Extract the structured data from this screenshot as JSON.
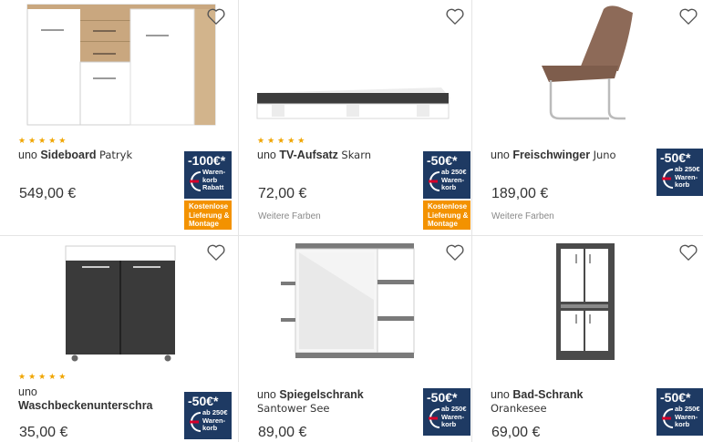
{
  "products": [
    {
      "brand": "uno",
      "name": "Sideboard",
      "suffix": "Patryk",
      "rating": "★★★★★",
      "price": "549,00 €",
      "colors_link": "",
      "badge": {
        "amount": "-100€*",
        "note": "Waren-korb Rabatt"
      },
      "delivery": "Kostenlose Lieferung & Montage"
    },
    {
      "brand": "uno",
      "name": "TV-Aufsatz",
      "suffix": "Skarn",
      "rating": "★★★★★",
      "price": "72,00 €",
      "colors_link": "Weitere Farben",
      "badge": {
        "amount": "-50€*",
        "note": "ab 250€ Waren-korb"
      },
      "delivery": "Kostenlose Lieferung & Montage"
    },
    {
      "brand": "uno",
      "name": "Freischwinger",
      "suffix": "Juno",
      "rating": "",
      "price": "189,00 €",
      "colors_link": "Weitere Farben",
      "badge": {
        "amount": "-50€*",
        "note": "ab 250€ Waren-korb"
      },
      "delivery": ""
    },
    {
      "brand": "uno",
      "name": "Waschbeckenunterschra",
      "suffix": "",
      "rating": "★★★★★",
      "price": "35,00 €",
      "colors_link": "",
      "badge": {
        "amount": "-50€*",
        "note": "ab 250€ Waren-korb"
      },
      "delivery": ""
    },
    {
      "brand": "uno",
      "name": "Spiegelschrank",
      "suffix": "Santower See",
      "rating": "",
      "price": "89,00 €",
      "colors_link": "",
      "badge": {
        "amount": "-50€*",
        "note": "ab 250€ Waren-korb"
      },
      "delivery": ""
    },
    {
      "brand": "uno",
      "name": "Bad-Schrank",
      "suffix": "Orankesee",
      "rating": "",
      "price": "69,00 €",
      "colors_link": "",
      "badge": {
        "amount": "-50€*",
        "note": "ab 250€ Waren-korb"
      },
      "delivery": ""
    }
  ],
  "icons": {
    "favorite": "heart-outline-icon",
    "rating": "star-icon"
  },
  "colors": {
    "badge_bg": "#1e3a63",
    "delivery_bg": "#f39200",
    "star": "#f0a500",
    "badge_accent": "#d6002a"
  }
}
